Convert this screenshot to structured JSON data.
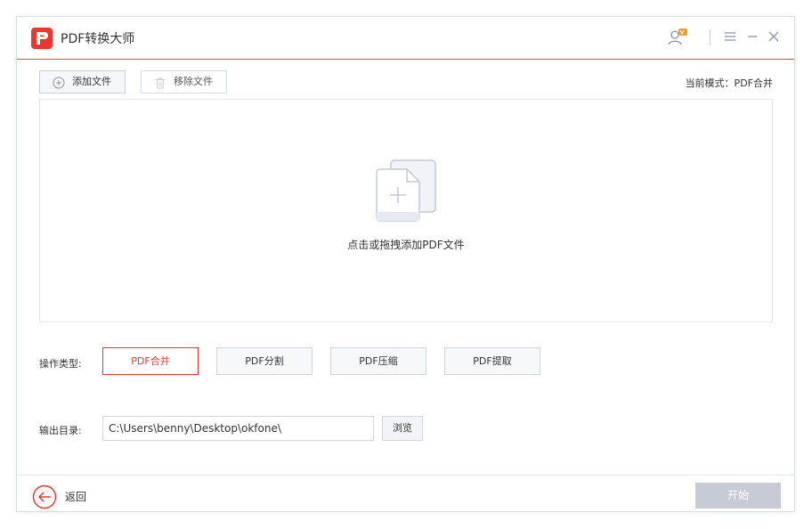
{
  "app": {
    "title": "PDF转换大师"
  },
  "toolbar": {
    "add_label": "添加文件",
    "remove_label": "移除文件",
    "mode_text": "当前模式：PDF合并"
  },
  "dropzone": {
    "hint": "点击或拖拽添加PDF文件"
  },
  "operation": {
    "label": "操作类型:",
    "options": [
      "PDF合并",
      "PDF分割",
      "PDF压缩",
      "PDF提取"
    ],
    "selected": "PDF合并"
  },
  "output": {
    "label": "输出目录:",
    "path": "C:\\Users\\benny\\Desktop\\okfone\\",
    "browse_label": "浏览"
  },
  "footer": {
    "back_label": "返回",
    "start_label": "开始"
  },
  "colors": {
    "accent": "#e8382f",
    "start_disabled": "#c6cbd6",
    "vip_badge": "#f39a2b"
  },
  "icons": {
    "logo": "app-logo",
    "user": "user-vip-icon",
    "menu": "menu-icon",
    "minimize": "minimize-icon",
    "close": "close-icon",
    "add": "plus-circle-icon",
    "remove": "trash-icon",
    "drop": "add-file-icon",
    "back": "back-arrow-icon"
  }
}
